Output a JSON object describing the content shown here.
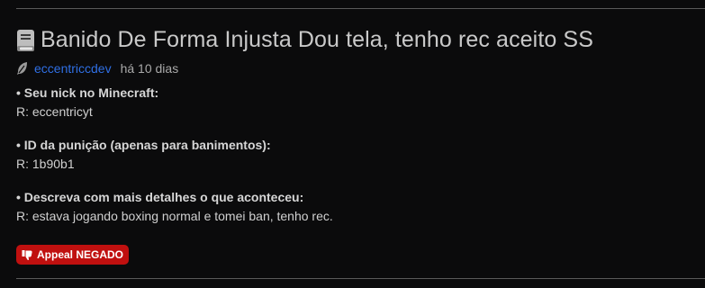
{
  "thread": {
    "title": "Banido De Forma Injusta Dou tela, tenho rec aceito SS",
    "title_icon": "book-icon",
    "author": "eccentriccdev",
    "time": "há 10 dias"
  },
  "form": [
    {
      "question": "• Seu nick no Minecraft:",
      "answer": "R: eccentricyt"
    },
    {
      "question": "• ID da punição (apenas para banimentos):",
      "answer": "R: 1b90b1"
    },
    {
      "question": "• Descreva com mais detalhes o que aconteceu:",
      "answer": "R: estava jogando boxing normal e tomei ban, tenho rec."
    }
  ],
  "status_badge": {
    "label": "Appeal NEGADO",
    "icon": "thumbs-down-icon",
    "color": "#c0100f"
  }
}
